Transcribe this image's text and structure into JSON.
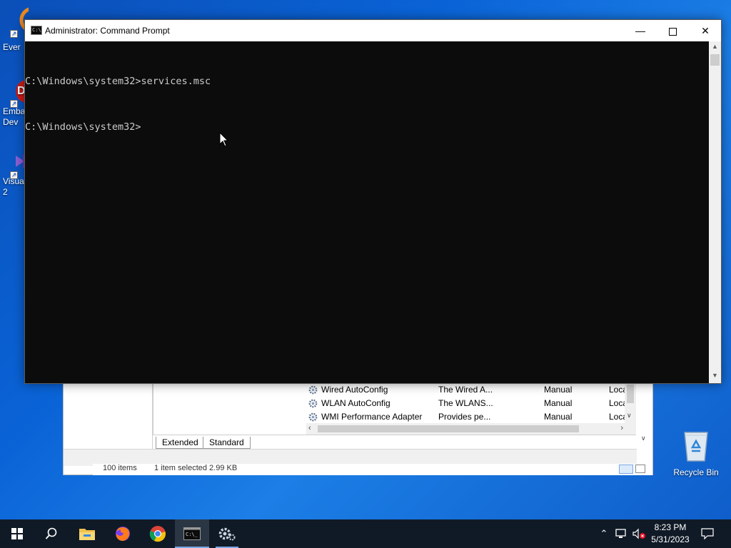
{
  "desktop": {
    "icons": [
      {
        "label": "Ever"
      },
      {
        "label": "Emba Dev"
      },
      {
        "label": "Visua 2"
      }
    ],
    "recycle_bin": {
      "label": "Recycle Bin"
    }
  },
  "background_window": {
    "services": [
      {
        "name": "Wired AutoConfig",
        "description": "The Wired A...",
        "startup": "Manual",
        "logon": "Loca"
      },
      {
        "name": "WLAN AutoConfig",
        "description": "The WLANS...",
        "startup": "Manual",
        "logon": "Loca"
      },
      {
        "name": "WMI Performance Adapter",
        "description": "Provides pe...",
        "startup": "Manual",
        "logon": "Loca"
      }
    ],
    "tabs": [
      "Extended",
      "Standard"
    ],
    "status": {
      "items": "100 items",
      "selected": "1 item selected  2.99 KB"
    }
  },
  "cmd_window": {
    "title": "Administrator: Command Prompt",
    "lines": [
      "C:\\Windows\\system32>services.msc",
      "C:\\Windows\\system32>"
    ]
  },
  "taskbar": {
    "apps": [
      "start-icon",
      "search-icon",
      "file-explorer-icon",
      "firefox-icon",
      "chrome-icon",
      "command-prompt-icon",
      "services-icon"
    ],
    "clock": {
      "time": "8:23 PM",
      "date": "5/31/2023"
    }
  },
  "colors": {
    "desktop_blue": "#0a63d6",
    "console_bg": "#0c0c0c",
    "console_text": "#cccccc",
    "taskbar_bg": "#101a27"
  }
}
